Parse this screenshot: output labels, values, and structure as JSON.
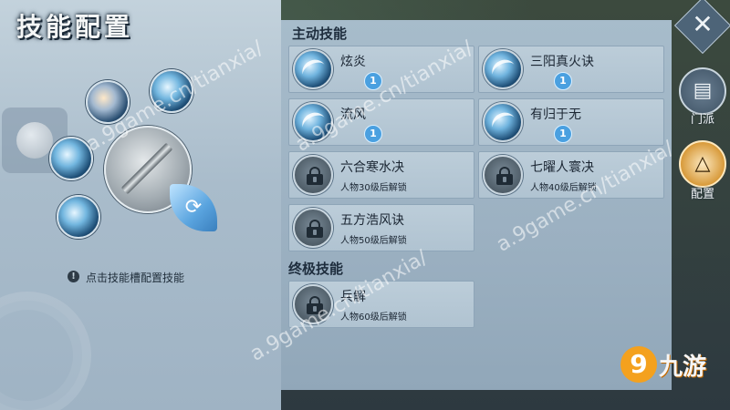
{
  "title": "技能配置",
  "hint": "点击技能槽配置技能",
  "main": {
    "active_section": "主动技能",
    "ultimate_section": "终极技能",
    "active_skills": [
      {
        "name": "炫炎",
        "level": "1",
        "locked": false
      },
      {
        "name": "三阳真火诀",
        "level": "1",
        "locked": false
      },
      {
        "name": "流风",
        "level": "1",
        "locked": false
      },
      {
        "name": "有归于无",
        "level": "1",
        "locked": false
      },
      {
        "name": "六合寒水决",
        "unlock": "人物30级后解锁",
        "locked": true
      },
      {
        "name": "七曜人寰决",
        "unlock": "人物40级后解锁",
        "locked": true
      },
      {
        "name": "五方浩风诀",
        "unlock": "人物50级后解锁",
        "locked": true
      }
    ],
    "ultimate_skills": [
      {
        "name": "兵解",
        "unlock": "人物60级后解锁",
        "locked": true
      }
    ]
  },
  "side_nav": {
    "close": "✕",
    "sect_label": "门派",
    "config_label": "配置"
  },
  "watermark": "a.9game.cn/tianxia/",
  "logo_text": "九游",
  "icons": {
    "close": "close-icon",
    "sect": "book-icon",
    "config": "triangle-config-icon",
    "switch": "refresh-icon",
    "hint": "info-icon"
  },
  "colors": {
    "accent": "#4aa0e0",
    "active_nav": "#d89a3a"
  }
}
